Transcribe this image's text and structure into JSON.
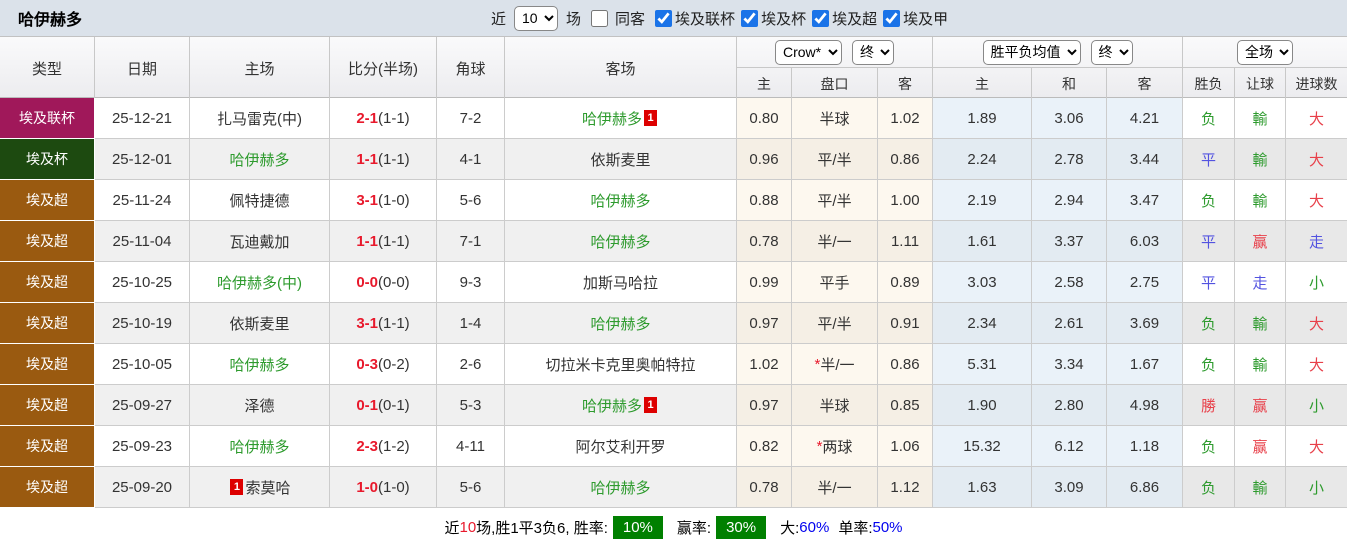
{
  "colors": {
    "topbar-bg": "#dbe2ea",
    "accent": "#1a73e8",
    "league1": "#a0185a",
    "league2": "#1d4a10",
    "league3": "#9a5a10",
    "green": "#2e9b2e",
    "red": "#e8404a",
    "blue": "#5353e0",
    "score-red": "#e8192c",
    "badge-red": "#dd0000",
    "cream": "#fdf8ef",
    "cream-even": "#f5efe5",
    "lightblue": "#eaf2f9",
    "lightblue-even": "#e3ebf2",
    "footer-green": "#008000",
    "footer-blue": "#0000ee"
  },
  "topbar": {
    "title": "哈伊赫多",
    "near_label": "近",
    "match_count": "10",
    "matches_label": "场",
    "checkboxes": [
      {
        "label": "同客",
        "checked": false
      },
      {
        "label": "埃及联杯",
        "checked": true
      },
      {
        "label": "埃及杯",
        "checked": true
      },
      {
        "label": "埃及超",
        "checked": true
      },
      {
        "label": "埃及甲",
        "checked": true
      }
    ]
  },
  "table": {
    "columns": [
      "类型",
      "日期",
      "主场",
      "比分(半场)",
      "角球",
      "客场",
      "主",
      "盘口",
      "客",
      "主",
      "和",
      "客",
      "胜负",
      "让球",
      "进球数"
    ],
    "selects": {
      "odds_source": "Crow*",
      "odds_time": "终",
      "avg_type": "胜平负均值",
      "avg_time": "终",
      "scope": "全场"
    },
    "rows": [
      {
        "league": "埃及联杯",
        "league_cls": "lg1",
        "date": "25-12-21",
        "home": "扎马雷克(中)",
        "home_cl": "k",
        "score_ft": "2-1",
        "score_ht": "(1-1)",
        "corners": "7-2",
        "away": "哈伊赫多",
        "away_cl": "g",
        "away_red": "1",
        "odds_home": "0.80",
        "handicap_star": "",
        "handicap": "半球",
        "odds_away": "1.02",
        "avg_home": "1.89",
        "avg_draw": "3.06",
        "avg_away": "4.21",
        "res_wdl": "负",
        "res_wdl_cl": "g",
        "res_handicap": "輸",
        "res_handicap_cl": "g",
        "res_goals": "大",
        "res_goals_cl": "r"
      },
      {
        "league": "埃及杯",
        "league_cls": "lg2",
        "date": "25-12-01",
        "home": "哈伊赫多",
        "home_cl": "g",
        "score_ft": "1-1",
        "score_ht": "(1-1)",
        "corners": "4-1",
        "away": "依斯麦里",
        "away_cl": "k",
        "away_red": "",
        "odds_home": "0.96",
        "handicap_star": "",
        "handicap": "平/半",
        "odds_away": "0.86",
        "avg_home": "2.24",
        "avg_draw": "2.78",
        "avg_away": "3.44",
        "res_wdl": "平",
        "res_wdl_cl": "b",
        "res_handicap": "輸",
        "res_handicap_cl": "g",
        "res_goals": "大",
        "res_goals_cl": "r"
      },
      {
        "league": "埃及超",
        "league_cls": "lg3",
        "date": "25-11-24",
        "home": "佩特捷德",
        "home_cl": "k",
        "score_ft": "3-1",
        "score_ht": "(1-0)",
        "corners": "5-6",
        "away": "哈伊赫多",
        "away_cl": "g",
        "away_red": "",
        "odds_home": "0.88",
        "handicap_star": "",
        "handicap": "平/半",
        "odds_away": "1.00",
        "avg_home": "2.19",
        "avg_draw": "2.94",
        "avg_away": "3.47",
        "res_wdl": "负",
        "res_wdl_cl": "g",
        "res_handicap": "輸",
        "res_handicap_cl": "g",
        "res_goals": "大",
        "res_goals_cl": "r"
      },
      {
        "league": "埃及超",
        "league_cls": "lg3",
        "date": "25-11-04",
        "home": "瓦迪戴加",
        "home_cl": "k",
        "score_ft": "1-1",
        "score_ht": "(1-1)",
        "corners": "7-1",
        "away": "哈伊赫多",
        "away_cl": "g",
        "away_red": "",
        "odds_home": "0.78",
        "handicap_star": "",
        "handicap": "半/一",
        "odds_away": "1.11",
        "avg_home": "1.61",
        "avg_draw": "3.37",
        "avg_away": "6.03",
        "res_wdl": "平",
        "res_wdl_cl": "b",
        "res_handicap": "赢",
        "res_handicap_cl": "r",
        "res_goals": "走",
        "res_goals_cl": "b"
      },
      {
        "league": "埃及超",
        "league_cls": "lg3",
        "date": "25-10-25",
        "home": "哈伊赫多(中)",
        "home_cl": "g",
        "score_ft": "0-0",
        "score_ht": "(0-0)",
        "corners": "9-3",
        "away": "加斯马哈拉",
        "away_cl": "k",
        "away_red": "",
        "odds_home": "0.99",
        "handicap_star": "",
        "handicap": "平手",
        "odds_away": "0.89",
        "avg_home": "3.03",
        "avg_draw": "2.58",
        "avg_away": "2.75",
        "res_wdl": "平",
        "res_wdl_cl": "b",
        "res_handicap": "走",
        "res_handicap_cl": "b",
        "res_goals": "小",
        "res_goals_cl": "g"
      },
      {
        "league": "埃及超",
        "league_cls": "lg3",
        "date": "25-10-19",
        "home": "依斯麦里",
        "home_cl": "k",
        "score_ft": "3-1",
        "score_ht": "(1-1)",
        "corners": "1-4",
        "away": "哈伊赫多",
        "away_cl": "g",
        "away_red": "",
        "odds_home": "0.97",
        "handicap_star": "",
        "handicap": "平/半",
        "odds_away": "0.91",
        "avg_home": "2.34",
        "avg_draw": "2.61",
        "avg_away": "3.69",
        "res_wdl": "负",
        "res_wdl_cl": "g",
        "res_handicap": "輸",
        "res_handicap_cl": "g",
        "res_goals": "大",
        "res_goals_cl": "r"
      },
      {
        "league": "埃及超",
        "league_cls": "lg3",
        "date": "25-10-05",
        "home": "哈伊赫多",
        "home_cl": "g",
        "score_ft": "0-3",
        "score_ht": "(0-2)",
        "corners": "2-6",
        "away": "切拉米卡克里奥帕特拉",
        "away_cl": "k",
        "away_red": "",
        "odds_home": "1.02",
        "handicap_star": "*",
        "handicap": "半/一",
        "odds_away": "0.86",
        "avg_home": "5.31",
        "avg_draw": "3.34",
        "avg_away": "1.67",
        "res_wdl": "负",
        "res_wdl_cl": "g",
        "res_handicap": "輸",
        "res_handicap_cl": "g",
        "res_goals": "大",
        "res_goals_cl": "r"
      },
      {
        "league": "埃及超",
        "league_cls": "lg3",
        "date": "25-09-27",
        "home": "泽德",
        "home_cl": "k",
        "score_ft": "0-1",
        "score_ht": "(0-1)",
        "corners": "5-3",
        "away": "哈伊赫多",
        "away_cl": "g",
        "away_red": "1",
        "odds_home": "0.97",
        "handicap_star": "",
        "handicap": "半球",
        "odds_away": "0.85",
        "avg_home": "1.90",
        "avg_draw": "2.80",
        "avg_away": "4.98",
        "res_wdl": "勝",
        "res_wdl_cl": "r",
        "res_handicap": "赢",
        "res_handicap_cl": "r",
        "res_goals": "小",
        "res_goals_cl": "g"
      },
      {
        "league": "埃及超",
        "league_cls": "lg3",
        "date": "25-09-23",
        "home": "哈伊赫多",
        "home_cl": "g",
        "score_ft": "2-3",
        "score_ht": "(1-2)",
        "corners": "4-11",
        "away": "阿尔艾利开罗",
        "away_cl": "k",
        "away_red": "",
        "odds_home": "0.82",
        "handicap_star": "*",
        "handicap": "两球",
        "odds_away": "1.06",
        "avg_home": "15.32",
        "avg_draw": "6.12",
        "avg_away": "1.18",
        "res_wdl": "负",
        "res_wdl_cl": "g",
        "res_handicap": "赢",
        "res_handicap_cl": "r",
        "res_goals": "大",
        "res_goals_cl": "r"
      },
      {
        "league": "埃及超",
        "league_cls": "lg3",
        "date": "25-09-20",
        "home": "索莫哈",
        "home_cl": "k",
        "home_red": "1",
        "score_ft": "1-0",
        "score_ht": "(1-0)",
        "corners": "5-6",
        "away": "哈伊赫多",
        "away_cl": "g",
        "away_red": "",
        "odds_home": "0.78",
        "handicap_star": "",
        "handicap": "半/一",
        "odds_away": "1.12",
        "avg_home": "1.63",
        "avg_draw": "3.09",
        "avg_away": "6.86",
        "res_wdl": "负",
        "res_wdl_cl": "g",
        "res_handicap": "輸",
        "res_handicap_cl": "g",
        "res_goals": "小",
        "res_goals_cl": "g"
      }
    ]
  },
  "footer": {
    "seg1": "近",
    "seg2": "10",
    "seg3": "场,胜1平3负6, 胜率:",
    "win_rate": "10%",
    "seg4": "赢率:",
    "handicap_rate": "30%",
    "seg5": "大:",
    "over_rate": "60%",
    "seg6": "单率:",
    "odd_rate": "50%"
  }
}
